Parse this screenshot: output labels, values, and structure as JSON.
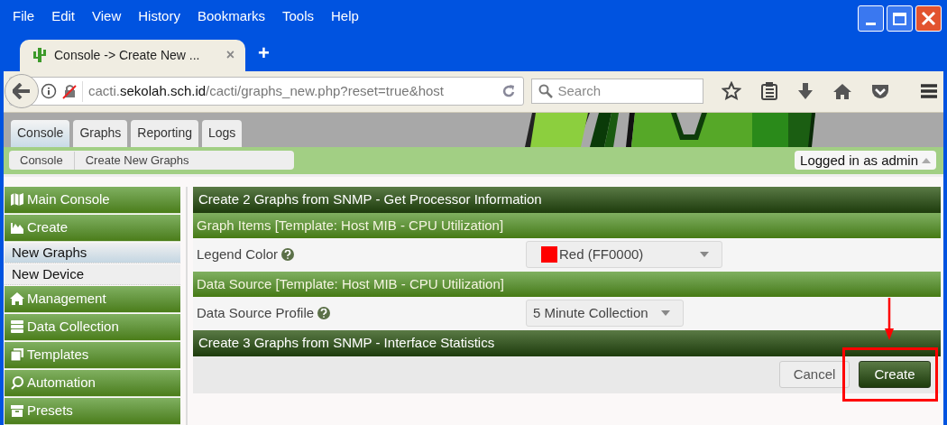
{
  "menu": [
    "File",
    "Edit",
    "View",
    "History",
    "Bookmarks",
    "Tools",
    "Help"
  ],
  "browser_tab": {
    "title": "Console -> Create New ...",
    "close": "×",
    "new_tab": "+"
  },
  "address": {
    "prefix": "cacti.",
    "domain": "sekolah.sch.id",
    "path": "/cacti/graphs_new.php?reset=true&host"
  },
  "search": {
    "placeholder": "Search"
  },
  "app_tabs": [
    {
      "label": "Console",
      "selected": true
    },
    {
      "label": "Graphs",
      "selected": false
    },
    {
      "label": "Reporting",
      "selected": false
    },
    {
      "label": "Logs",
      "selected": false
    }
  ],
  "breadcrumb": [
    "Console",
    "Create New Graphs"
  ],
  "user_menu": "Logged in as admin",
  "sidebar": [
    {
      "label": "Main Console"
    },
    {
      "label": "Create",
      "children": [
        {
          "label": "New Graphs",
          "selected": true
        },
        {
          "label": "New Device",
          "selected": false
        }
      ]
    },
    {
      "label": "Management"
    },
    {
      "label": "Data Collection"
    },
    {
      "label": "Templates"
    },
    {
      "label": "Automation"
    },
    {
      "label": "Presets"
    }
  ],
  "content": [
    {
      "kind": "header",
      "text": "Create 2 Graphs from SNMP - Get Processor Information"
    },
    {
      "kind": "subheader",
      "text": "Graph Items [Template: Host MIB - CPU Utilization]"
    },
    {
      "kind": "field",
      "label": "Legend Color",
      "value": "Red (FF0000)",
      "color": "#ff0000"
    },
    {
      "kind": "subheader",
      "text": "Data Source [Template: Host MIB - CPU Utilization]"
    },
    {
      "kind": "field",
      "label": "Data Source Profile",
      "value": "5 Minute Collection"
    },
    {
      "kind": "header",
      "text": "Create 3 Graphs from SNMP - Interface Statistics"
    }
  ],
  "buttons": [
    {
      "label": "Cancel",
      "kind": "secondary"
    },
    {
      "label": "Create",
      "kind": "primary",
      "highlighted": true
    }
  ]
}
